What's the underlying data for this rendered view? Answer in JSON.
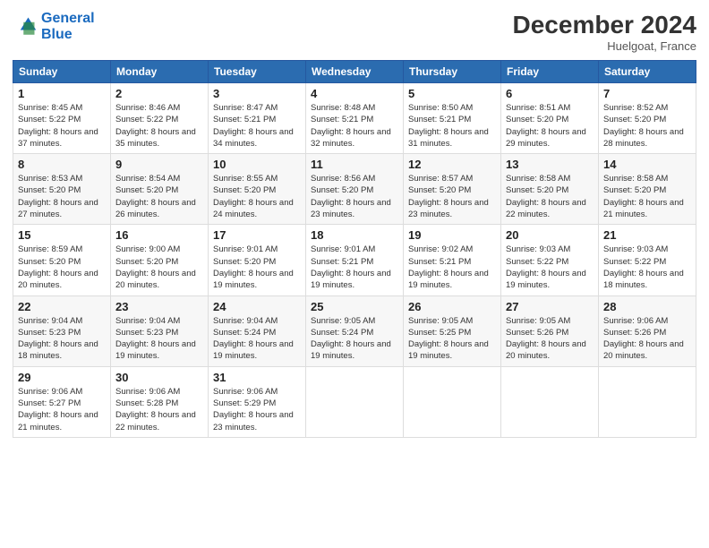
{
  "logo": {
    "line1": "General",
    "line2": "Blue"
  },
  "title": "December 2024",
  "location": "Huelgoat, France",
  "weekdays": [
    "Sunday",
    "Monday",
    "Tuesday",
    "Wednesday",
    "Thursday",
    "Friday",
    "Saturday"
  ],
  "weeks": [
    [
      {
        "day": "1",
        "sunrise": "Sunrise: 8:45 AM",
        "sunset": "Sunset: 5:22 PM",
        "daylight": "Daylight: 8 hours and 37 minutes."
      },
      {
        "day": "2",
        "sunrise": "Sunrise: 8:46 AM",
        "sunset": "Sunset: 5:22 PM",
        "daylight": "Daylight: 8 hours and 35 minutes."
      },
      {
        "day": "3",
        "sunrise": "Sunrise: 8:47 AM",
        "sunset": "Sunset: 5:21 PM",
        "daylight": "Daylight: 8 hours and 34 minutes."
      },
      {
        "day": "4",
        "sunrise": "Sunrise: 8:48 AM",
        "sunset": "Sunset: 5:21 PM",
        "daylight": "Daylight: 8 hours and 32 minutes."
      },
      {
        "day": "5",
        "sunrise": "Sunrise: 8:50 AM",
        "sunset": "Sunset: 5:21 PM",
        "daylight": "Daylight: 8 hours and 31 minutes."
      },
      {
        "day": "6",
        "sunrise": "Sunrise: 8:51 AM",
        "sunset": "Sunset: 5:20 PM",
        "daylight": "Daylight: 8 hours and 29 minutes."
      },
      {
        "day": "7",
        "sunrise": "Sunrise: 8:52 AM",
        "sunset": "Sunset: 5:20 PM",
        "daylight": "Daylight: 8 hours and 28 minutes."
      }
    ],
    [
      {
        "day": "8",
        "sunrise": "Sunrise: 8:53 AM",
        "sunset": "Sunset: 5:20 PM",
        "daylight": "Daylight: 8 hours and 27 minutes."
      },
      {
        "day": "9",
        "sunrise": "Sunrise: 8:54 AM",
        "sunset": "Sunset: 5:20 PM",
        "daylight": "Daylight: 8 hours and 26 minutes."
      },
      {
        "day": "10",
        "sunrise": "Sunrise: 8:55 AM",
        "sunset": "Sunset: 5:20 PM",
        "daylight": "Daylight: 8 hours and 24 minutes."
      },
      {
        "day": "11",
        "sunrise": "Sunrise: 8:56 AM",
        "sunset": "Sunset: 5:20 PM",
        "daylight": "Daylight: 8 hours and 23 minutes."
      },
      {
        "day": "12",
        "sunrise": "Sunrise: 8:57 AM",
        "sunset": "Sunset: 5:20 PM",
        "daylight": "Daylight: 8 hours and 23 minutes."
      },
      {
        "day": "13",
        "sunrise": "Sunrise: 8:58 AM",
        "sunset": "Sunset: 5:20 PM",
        "daylight": "Daylight: 8 hours and 22 minutes."
      },
      {
        "day": "14",
        "sunrise": "Sunrise: 8:58 AM",
        "sunset": "Sunset: 5:20 PM",
        "daylight": "Daylight: 8 hours and 21 minutes."
      }
    ],
    [
      {
        "day": "15",
        "sunrise": "Sunrise: 8:59 AM",
        "sunset": "Sunset: 5:20 PM",
        "daylight": "Daylight: 8 hours and 20 minutes."
      },
      {
        "day": "16",
        "sunrise": "Sunrise: 9:00 AM",
        "sunset": "Sunset: 5:20 PM",
        "daylight": "Daylight: 8 hours and 20 minutes."
      },
      {
        "day": "17",
        "sunrise": "Sunrise: 9:01 AM",
        "sunset": "Sunset: 5:20 PM",
        "daylight": "Daylight: 8 hours and 19 minutes."
      },
      {
        "day": "18",
        "sunrise": "Sunrise: 9:01 AM",
        "sunset": "Sunset: 5:21 PM",
        "daylight": "Daylight: 8 hours and 19 minutes."
      },
      {
        "day": "19",
        "sunrise": "Sunrise: 9:02 AM",
        "sunset": "Sunset: 5:21 PM",
        "daylight": "Daylight: 8 hours and 19 minutes."
      },
      {
        "day": "20",
        "sunrise": "Sunrise: 9:03 AM",
        "sunset": "Sunset: 5:22 PM",
        "daylight": "Daylight: 8 hours and 19 minutes."
      },
      {
        "day": "21",
        "sunrise": "Sunrise: 9:03 AM",
        "sunset": "Sunset: 5:22 PM",
        "daylight": "Daylight: 8 hours and 18 minutes."
      }
    ],
    [
      {
        "day": "22",
        "sunrise": "Sunrise: 9:04 AM",
        "sunset": "Sunset: 5:23 PM",
        "daylight": "Daylight: 8 hours and 18 minutes."
      },
      {
        "day": "23",
        "sunrise": "Sunrise: 9:04 AM",
        "sunset": "Sunset: 5:23 PM",
        "daylight": "Daylight: 8 hours and 19 minutes."
      },
      {
        "day": "24",
        "sunrise": "Sunrise: 9:04 AM",
        "sunset": "Sunset: 5:24 PM",
        "daylight": "Daylight: 8 hours and 19 minutes."
      },
      {
        "day": "25",
        "sunrise": "Sunrise: 9:05 AM",
        "sunset": "Sunset: 5:24 PM",
        "daylight": "Daylight: 8 hours and 19 minutes."
      },
      {
        "day": "26",
        "sunrise": "Sunrise: 9:05 AM",
        "sunset": "Sunset: 5:25 PM",
        "daylight": "Daylight: 8 hours and 19 minutes."
      },
      {
        "day": "27",
        "sunrise": "Sunrise: 9:05 AM",
        "sunset": "Sunset: 5:26 PM",
        "daylight": "Daylight: 8 hours and 20 minutes."
      },
      {
        "day": "28",
        "sunrise": "Sunrise: 9:06 AM",
        "sunset": "Sunset: 5:26 PM",
        "daylight": "Daylight: 8 hours and 20 minutes."
      }
    ],
    [
      {
        "day": "29",
        "sunrise": "Sunrise: 9:06 AM",
        "sunset": "Sunset: 5:27 PM",
        "daylight": "Daylight: 8 hours and 21 minutes."
      },
      {
        "day": "30",
        "sunrise": "Sunrise: 9:06 AM",
        "sunset": "Sunset: 5:28 PM",
        "daylight": "Daylight: 8 hours and 22 minutes."
      },
      {
        "day": "31",
        "sunrise": "Sunrise: 9:06 AM",
        "sunset": "Sunset: 5:29 PM",
        "daylight": "Daylight: 8 hours and 23 minutes."
      },
      null,
      null,
      null,
      null
    ]
  ]
}
